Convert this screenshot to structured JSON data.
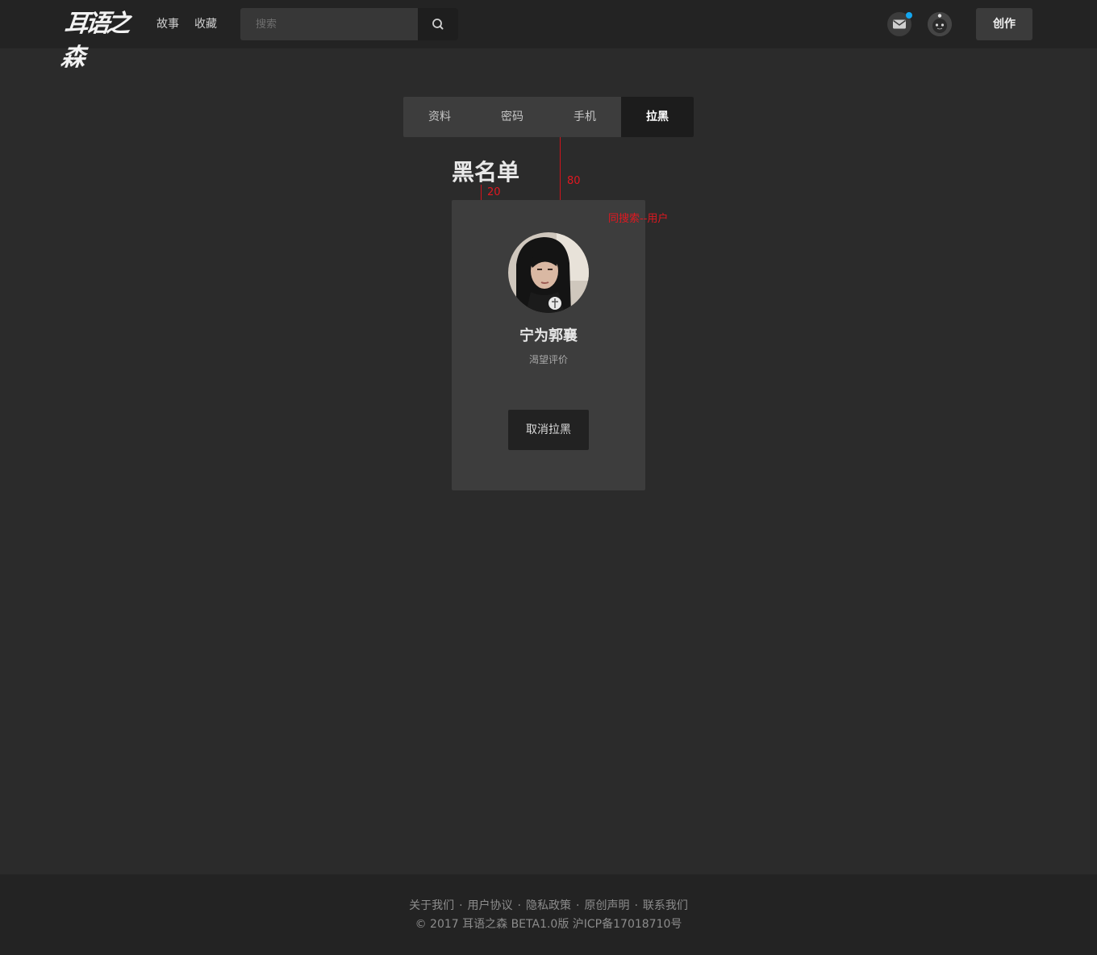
{
  "header": {
    "logo_text": "耳语之森",
    "nav": [
      {
        "label": "故事"
      },
      {
        "label": "收藏"
      }
    ],
    "search": {
      "placeholder": "搜索",
      "value": ""
    },
    "create_label": "创作",
    "mail_has_notification": true
  },
  "tabs": [
    {
      "label": "资料",
      "active": false
    },
    {
      "label": "密码",
      "active": false
    },
    {
      "label": "手机",
      "active": false
    },
    {
      "label": "拉黑",
      "active": true
    }
  ],
  "page_title": "黑名单",
  "annotations": {
    "gap_title_card": "20",
    "gap_tabs_card": "80",
    "note": "同搜索--用户"
  },
  "blocked_user": {
    "name": "宁为郭襄",
    "subtitle": "渴望评价",
    "action_label": "取消拉黑"
  },
  "footer": {
    "links": [
      "关于我们",
      "用户协议",
      "隐私政策",
      "原创声明",
      "联系我们"
    ],
    "separator": "·",
    "copyright": "© 2017 耳语之森 BETA1.0版 沪ICP备17018710号"
  },
  "colors": {
    "background": "#2b2b2b",
    "header": "#232323",
    "card": "#3d3d3d",
    "active_tab": "#1c1c1c",
    "notification": "#13a6ef",
    "annotation": "#e01820"
  }
}
